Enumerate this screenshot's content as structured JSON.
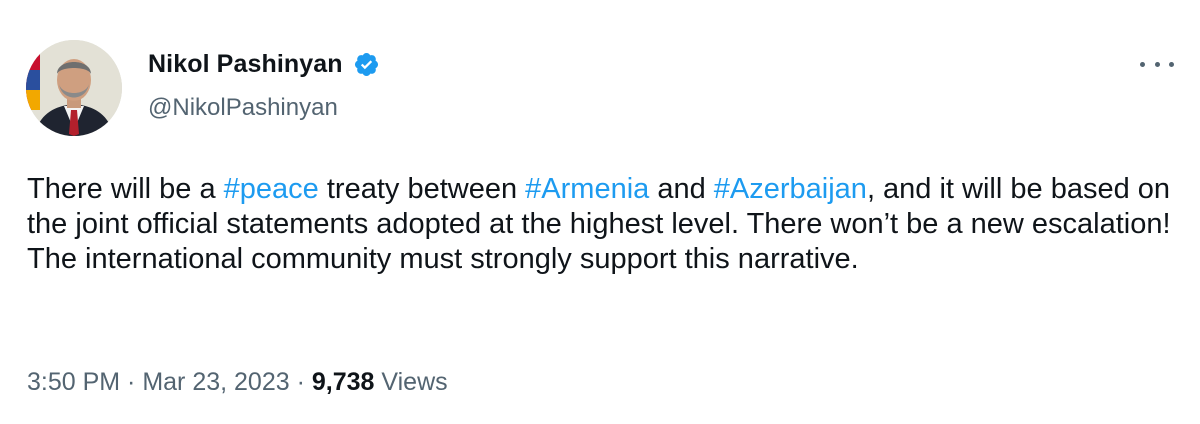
{
  "author": {
    "display_name": "Nikol Pashinyan",
    "handle": "@NikolPashinyan",
    "verified": true,
    "verified_color": "#1d9bf0"
  },
  "menu": {
    "icon": "more-horizontal-icon"
  },
  "tweet": {
    "segments": [
      {
        "type": "text",
        "text": "There will be a "
      },
      {
        "type": "hashtag",
        "text": "#peace"
      },
      {
        "type": "text",
        "text": " treaty between "
      },
      {
        "type": "hashtag",
        "text": "#Armenia"
      },
      {
        "type": "text",
        "text": " and "
      },
      {
        "type": "hashtag",
        "text": "#Azerbaijan"
      },
      {
        "type": "text",
        "text": ", and it will be based on the joint official statements adopted at the highest level. There won’t be a new escalation! The international community must strongly support this narrative."
      }
    ],
    "hashtag_color": "#1d9bf0"
  },
  "meta": {
    "time": "3:50 PM",
    "separator": " · ",
    "date": "Mar 23, 2023",
    "views_count": "9,738",
    "views_label": " Views"
  }
}
